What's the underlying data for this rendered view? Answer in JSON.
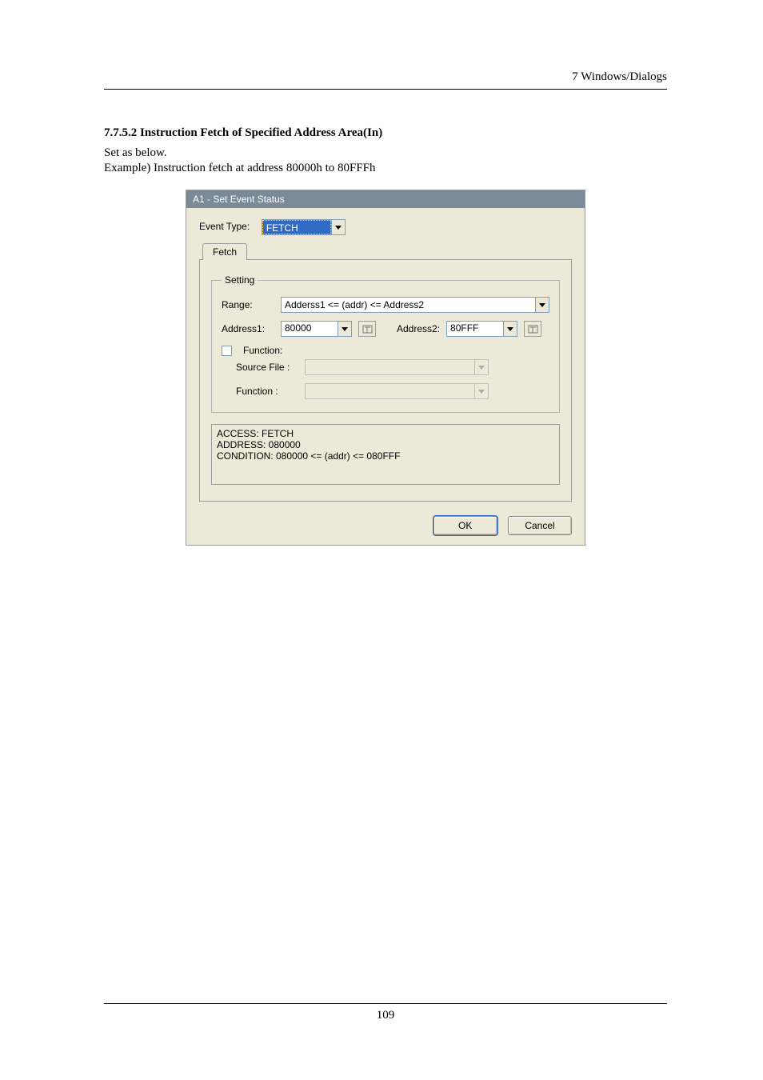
{
  "header": {
    "right": "7  Windows/Dialogs"
  },
  "section": {
    "title": "7.7.5.2 Instruction Fetch of Specified Address Area(In)",
    "line1": "Set as below.",
    "line2": "Example) Instruction fetch at address 80000h to 80FFFh"
  },
  "dialog": {
    "title": "A1 - Set Event Status",
    "event_type_label": "Event Type:",
    "event_type_value": "FETCH",
    "tab_label": "Fetch",
    "group_legend": "Setting",
    "range_label": "Range:",
    "range_value": "Adderss1 <= (addr) <= Address2",
    "address1_label": "Address1:",
    "address1_value": "80000",
    "address2_label": "Address2:",
    "address2_value": "80FFF",
    "function_checkbox_label": "Function:",
    "source_file_label": "Source File :",
    "function_label": "Function :",
    "status_line1": "ACCESS: FETCH",
    "status_line2": "ADDRESS: 080000",
    "status_line3": "CONDITION: 080000 <= (addr) <= 080FFF",
    "ok": "OK",
    "cancel": "Cancel"
  },
  "footer": {
    "page": "109"
  }
}
